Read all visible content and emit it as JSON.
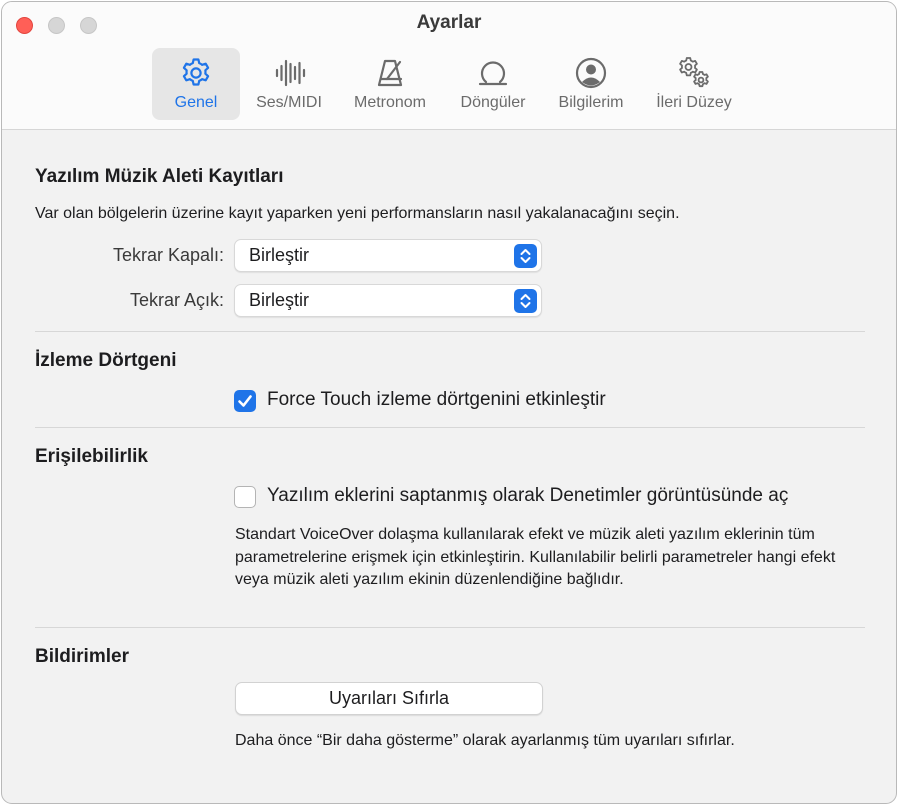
{
  "window": {
    "title": "Ayarlar"
  },
  "toolbar": {
    "tabs": [
      {
        "label": "Genel",
        "icon": "gear-icon",
        "active": true
      },
      {
        "label": "Ses/MIDI",
        "icon": "waveform-icon",
        "active": false
      },
      {
        "label": "Metronom",
        "icon": "metronome-icon",
        "active": false
      },
      {
        "label": "Döngüler",
        "icon": "loop-icon",
        "active": false
      },
      {
        "label": "Bilgilerim",
        "icon": "person-circle-icon",
        "active": false
      },
      {
        "label": "İleri Düzey",
        "icon": "gears-icon",
        "active": false
      }
    ]
  },
  "recording": {
    "title": "Yazılım Müzik Aleti Kayıtları",
    "description": "Var olan bölgelerin üzerine kayıt yaparken yeni performansların nasıl yakalanacağını seçin.",
    "cycle_off_label": "Tekrar Kapalı:",
    "cycle_off_value": "Birleştir",
    "cycle_on_label": "Tekrar Açık:",
    "cycle_on_value": "Birleştir"
  },
  "trackpad": {
    "title": "İzleme Dörtgeni",
    "force_touch_label": "Force Touch izleme dörtgenini etkinleştir",
    "force_touch_checked": true
  },
  "accessibility": {
    "title": "Erişilebilirlik",
    "plugins_label": "Yazılım eklerini saptanmış olarak Denetimler görüntüsünde aç",
    "plugins_checked": false,
    "help": "Standart VoiceOver dolaşma kullanılarak efekt ve müzik aleti yazılım eklerinin tüm parametrelerine erişmek için etkinleştirin. Kullanılabilir belirli parametreler hangi efekt veya müzik aleti yazılım ekinin düzenlendiğine bağlıdır."
  },
  "notifications": {
    "title": "Bildirimler",
    "reset_button": "Uyarıları Sıfırla",
    "help": "Daha önce “Bir daha gösterme” olarak ayarlanmış tüm uyarıları sıfırlar."
  },
  "colors": {
    "accent": "#1f74e8",
    "close_button": "#ff5f57"
  }
}
